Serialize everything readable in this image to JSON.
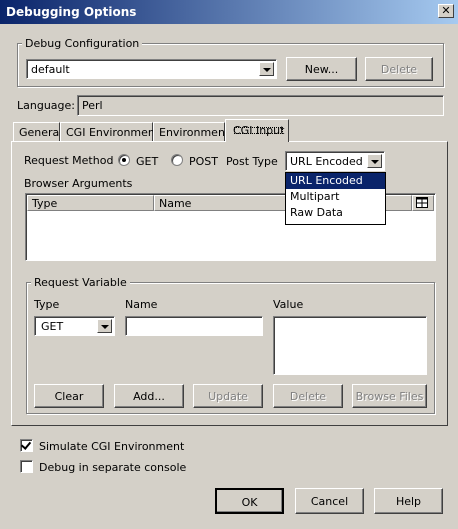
{
  "window": {
    "title": "Debugging Options",
    "close_glyph": "✕"
  },
  "debug_config": {
    "legend": "Debug Configuration",
    "selected": "default",
    "new_label": "New...",
    "delete_label": "Delete"
  },
  "language": {
    "label": "Language:",
    "value": "Perl"
  },
  "tabs": [
    {
      "label": "General"
    },
    {
      "label": "CGI Environment"
    },
    {
      "label": "Environment"
    },
    {
      "label": "CGI Input"
    }
  ],
  "cgi_input": {
    "request_method_label": "Request Method",
    "method_options": [
      {
        "label": "GET",
        "checked": true
      },
      {
        "label": "POST",
        "checked": false
      }
    ],
    "post_type_label": "Post Type",
    "post_type_selected": "URL Encoded",
    "post_type_options": [
      "URL Encoded",
      "Multipart",
      "Raw Data"
    ],
    "browser_args_label": "Browser Arguments",
    "columns": [
      "Type",
      "Name"
    ],
    "request_variable": {
      "legend": "Request Variable",
      "type_label": "Type",
      "type_selected": "GET",
      "name_label": "Name",
      "name_value": "",
      "value_label": "Value",
      "value_value": "",
      "buttons": {
        "clear": "Clear",
        "add": "Add...",
        "update": "Update",
        "delete": "Delete",
        "browse": "Browse Files"
      }
    }
  },
  "options": [
    {
      "label": "Simulate CGI Environment",
      "checked": true
    },
    {
      "label": "Debug in separate console",
      "checked": false
    }
  ],
  "footer": {
    "ok": "OK",
    "cancel": "Cancel",
    "help": "Help"
  }
}
